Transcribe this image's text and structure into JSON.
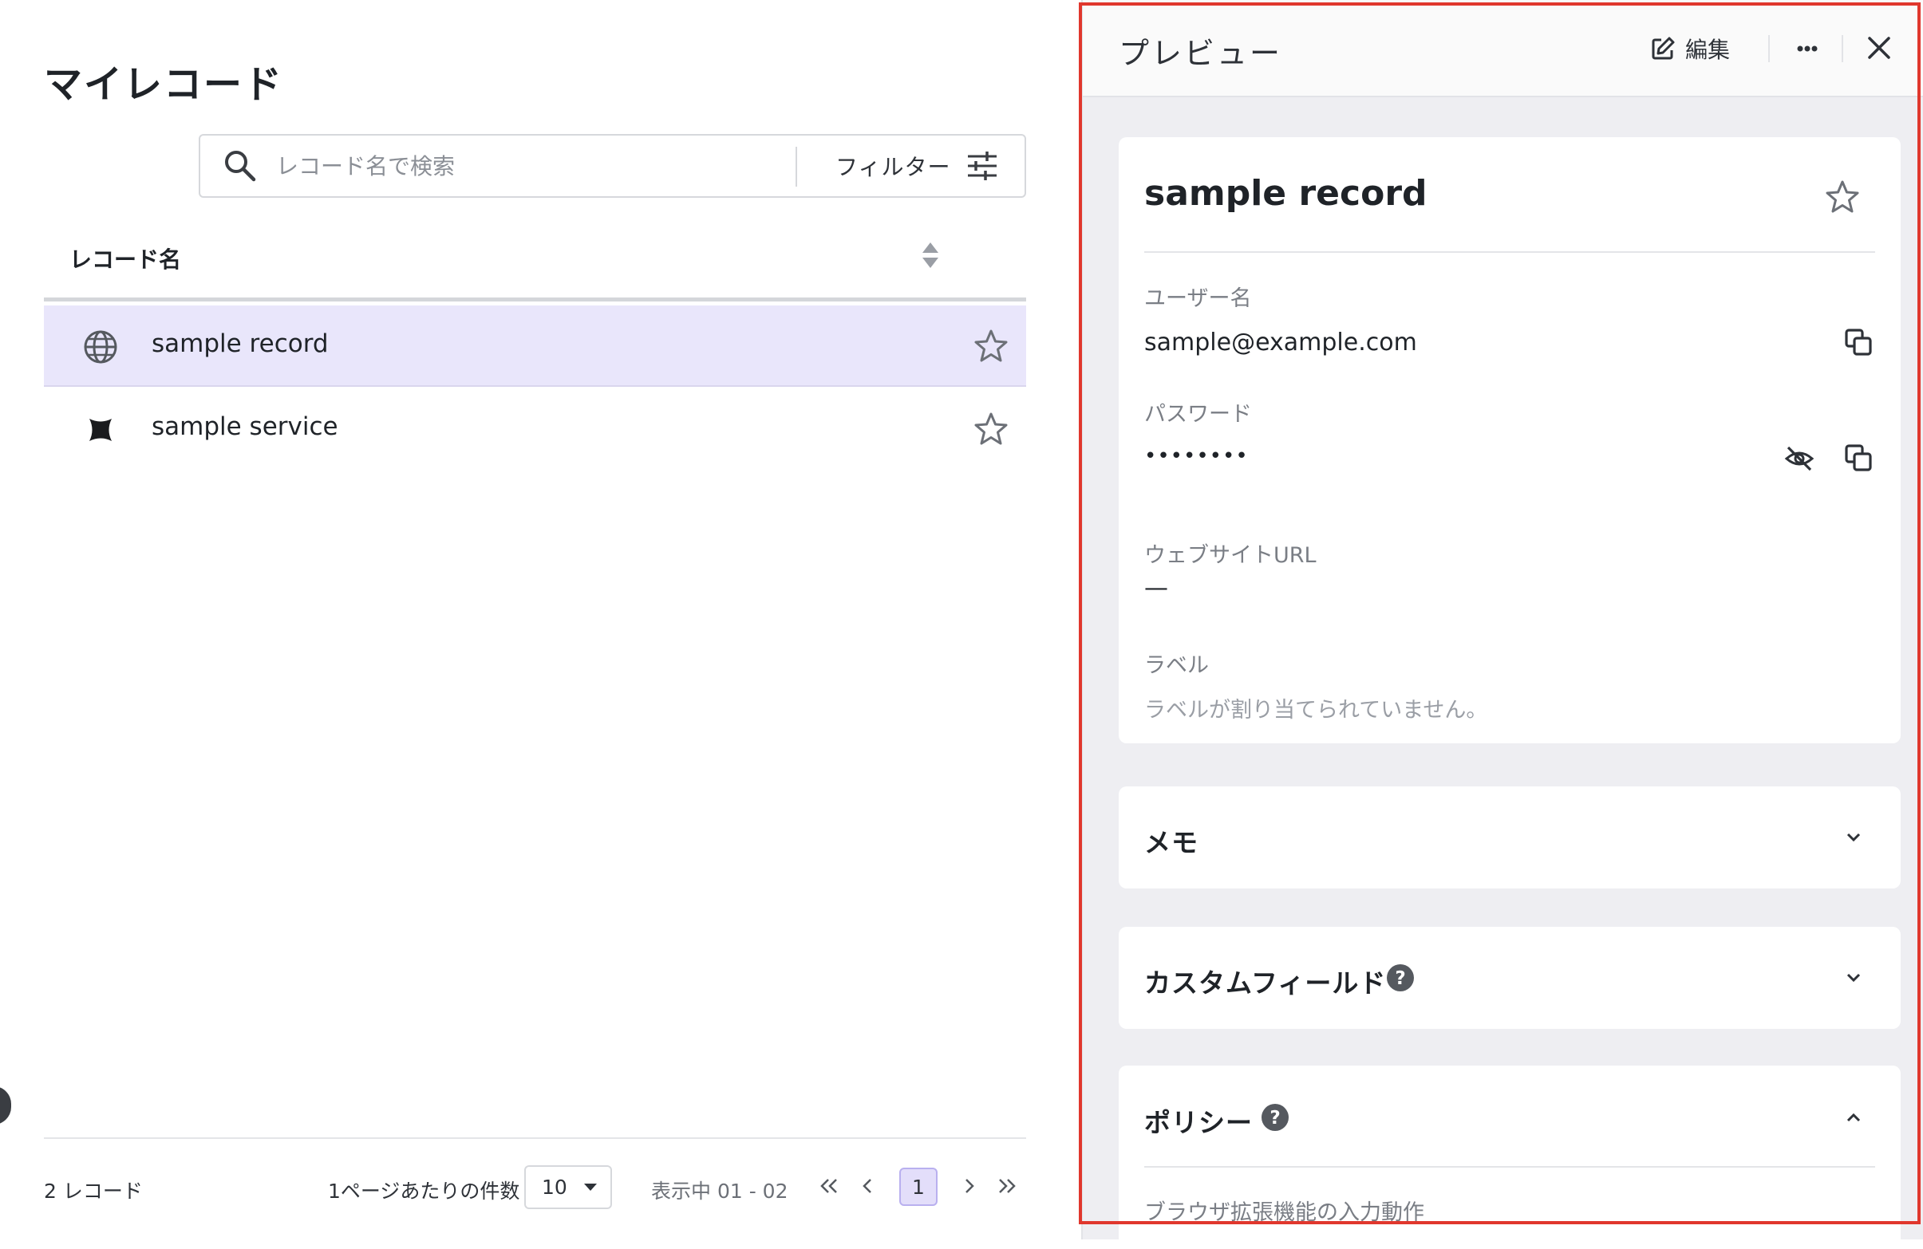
{
  "list": {
    "title": "マイレコード",
    "search": {
      "placeholder": "レコード名で検索",
      "value": ""
    },
    "filter_label": "フィルター",
    "column_header": "レコード名",
    "rows": [
      {
        "label": "sample record",
        "icon": "globe-icon",
        "selected": true,
        "starred": false
      },
      {
        "label": "sample service",
        "icon": "service-logo-icon",
        "selected": false,
        "starred": false
      }
    ],
    "footer": {
      "count": "2 レコード",
      "per_page_label": "1ページあたりの件数",
      "per_page_value": "10",
      "range": "表示中 01 - 02",
      "current_page": "1"
    }
  },
  "preview": {
    "title": "プレビュー",
    "edit_label": "編集",
    "record": {
      "name": "sample record",
      "username_label": "ユーザー名",
      "username": "sample@example.com",
      "password_label": "パスワード",
      "password": "••••••••",
      "url_label": "ウェブサイトURL",
      "url": "—",
      "labels_label": "ラベル",
      "labels_empty": "ラベルが割り当てられていません。"
    },
    "sections": {
      "memo": "メモ",
      "custom_fields": "カスタムフィールド",
      "policy": "ポリシー",
      "policy_item": "ブラウザ拡張機能の入力動作"
    }
  },
  "colors": {
    "accent_selected": "#e9e6fb",
    "page_current": "#e3defa",
    "highlight_outline": "#e0372d",
    "panel_bg": "#eeeef2"
  }
}
